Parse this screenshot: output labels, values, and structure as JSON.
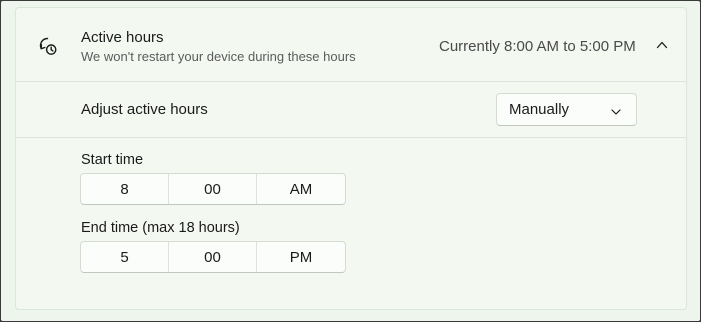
{
  "active_hours": {
    "title": "Active hours",
    "subtitle": "We won't restart your device during these hours",
    "status": "Currently 8:00 AM to 5:00 PM",
    "icon": "clock-refresh-icon",
    "collapse_icon": "chevron-up-icon"
  },
  "adjust": {
    "label": "Adjust active hours",
    "selected": "Manually",
    "icon": "chevron-down-icon"
  },
  "start_time": {
    "label": "Start time",
    "hour": "8",
    "minute": "00",
    "period": "AM"
  },
  "end_time": {
    "label": "End time (max 18 hours)",
    "hour": "5",
    "minute": "00",
    "period": "PM"
  }
}
